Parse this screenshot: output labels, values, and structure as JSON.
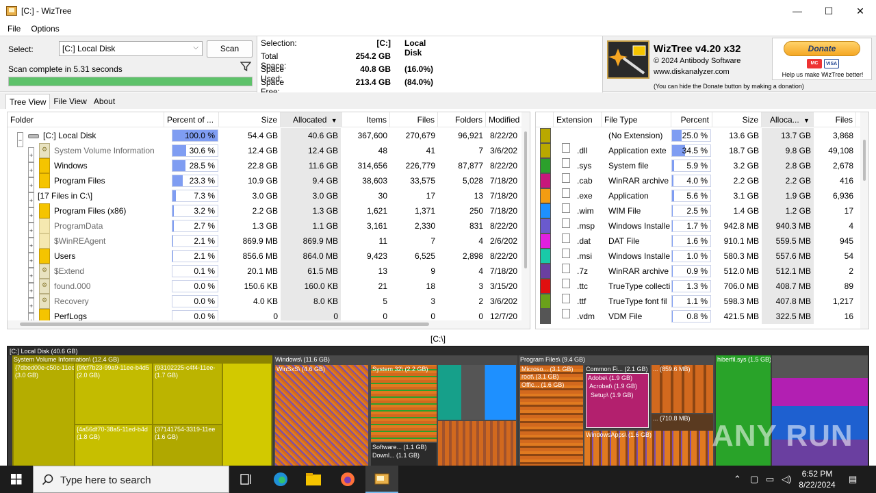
{
  "window": {
    "title": "[C:]  - WizTree",
    "minimize": "—",
    "maximize": "☐",
    "close": "✕"
  },
  "menu": [
    "File",
    "Options"
  ],
  "scan": {
    "select_label": "Select:",
    "drive": "[C:] Local Disk",
    "scan_button": "Scan",
    "status": "Scan complete in 5.31 seconds",
    "progress": 1.0
  },
  "selection": {
    "rows": [
      {
        "label": "Selection:",
        "value": "[C:]",
        "extra": "Local Disk"
      },
      {
        "label": "Total Space:",
        "value": "254.2 GB",
        "extra": ""
      },
      {
        "label": "Space Used:",
        "value": "40.8 GB",
        "extra": "(16.0%)"
      },
      {
        "label": "Space Free:",
        "value": "213.4 GB",
        "extra": "(84.0%)"
      }
    ]
  },
  "brand": {
    "name": "WizTree v4.20 x32",
    "copyright": "© 2024 Antibody Software",
    "website": "www.diskanalyzer.com",
    "hint": "(You can hide the Donate button by making a donation)"
  },
  "donate": {
    "button": "Donate",
    "card1": "MC",
    "card2": "VISA",
    "sub": "Help us make WizTree better!"
  },
  "tabs": [
    "Tree View",
    "File View",
    "About"
  ],
  "folder_table": {
    "columns": [
      "Folder",
      "Percent of ...",
      "Size",
      "Allocated",
      "Items",
      "Files",
      "Folders",
      "Modified"
    ],
    "rows": [
      {
        "name": "[C:] Local Disk",
        "pct": 100.0,
        "pct_text": "100.0 %",
        "size": "54.4 GB",
        "alloc": "40.6 GB",
        "items": "367,600",
        "files": "270,679",
        "folders": "96,921",
        "modified": "8/22/20",
        "icon": "disk",
        "dim": false,
        "level": 0
      },
      {
        "name": "System Volume Information",
        "pct": 30.6,
        "pct_text": "30.6 %",
        "size": "12.4 GB",
        "alloc": "12.4 GB",
        "items": "48",
        "files": "41",
        "folders": "7",
        "modified": "3/6/202",
        "icon": "sys",
        "dim": true,
        "level": 1
      },
      {
        "name": "Windows",
        "pct": 28.5,
        "pct_text": "28.5 %",
        "size": "22.8 GB",
        "alloc": "11.6 GB",
        "items": "314,656",
        "files": "226,779",
        "folders": "87,877",
        "modified": "8/22/20",
        "icon": "yellow",
        "dim": false,
        "level": 1
      },
      {
        "name": "Program Files",
        "pct": 23.3,
        "pct_text": "23.3 %",
        "size": "10.9 GB",
        "alloc": "9.4 GB",
        "items": "38,603",
        "files": "33,575",
        "folders": "5,028",
        "modified": "7/18/20",
        "icon": "yellow",
        "dim": false,
        "level": 1
      },
      {
        "name": "[17 Files in C:\\]",
        "pct": 7.3,
        "pct_text": "7.3 %",
        "size": "3.0 GB",
        "alloc": "3.0 GB",
        "items": "30",
        "files": "17",
        "folders": "13",
        "modified": "7/18/20",
        "icon": "none",
        "dim": false,
        "level": 1
      },
      {
        "name": "Program Files (x86)",
        "pct": 3.2,
        "pct_text": "3.2 %",
        "size": "2.2 GB",
        "alloc": "1.3 GB",
        "items": "1,621",
        "files": "1,371",
        "folders": "250",
        "modified": "7/18/20",
        "icon": "yellow",
        "dim": false,
        "level": 1
      },
      {
        "name": "ProgramData",
        "pct": 2.7,
        "pct_text": "2.7 %",
        "size": "1.3 GB",
        "alloc": "1.1 GB",
        "items": "3,161",
        "files": "2,330",
        "folders": "831",
        "modified": "8/22/20",
        "icon": "pale",
        "dim": true,
        "level": 1
      },
      {
        "name": "$WinREAgent",
        "pct": 2.1,
        "pct_text": "2.1 %",
        "size": "869.9 MB",
        "alloc": "869.9 MB",
        "items": "11",
        "files": "7",
        "folders": "4",
        "modified": "2/6/202",
        "icon": "pale",
        "dim": true,
        "level": 1
      },
      {
        "name": "Users",
        "pct": 2.1,
        "pct_text": "2.1 %",
        "size": "856.6 MB",
        "alloc": "864.0 MB",
        "items": "9,423",
        "files": "6,525",
        "folders": "2,898",
        "modified": "8/22/20",
        "icon": "yellow",
        "dim": false,
        "level": 1
      },
      {
        "name": "$Extend",
        "pct": 0.1,
        "pct_text": "0.1 %",
        "size": "20.1 MB",
        "alloc": "61.5 MB",
        "items": "13",
        "files": "9",
        "folders": "4",
        "modified": "7/18/20",
        "icon": "sys",
        "dim": true,
        "level": 1
      },
      {
        "name": "found.000",
        "pct": 0.0,
        "pct_text": "0.0 %",
        "size": "150.6 KB",
        "alloc": "160.0 KB",
        "items": "21",
        "files": "18",
        "folders": "3",
        "modified": "3/15/20",
        "icon": "sys",
        "dim": true,
        "level": 1
      },
      {
        "name": "Recovery",
        "pct": 0.0,
        "pct_text": "0.0 %",
        "size": "4.0 KB",
        "alloc": "8.0 KB",
        "items": "5",
        "files": "3",
        "folders": "2",
        "modified": "3/6/202",
        "icon": "sys",
        "dim": true,
        "level": 1
      },
      {
        "name": "PerfLogs",
        "pct": 0.0,
        "pct_text": "0.0 %",
        "size": "0",
        "alloc": "0",
        "items": "0",
        "files": "0",
        "folders": "0",
        "modified": "12/7/20",
        "icon": "yellow",
        "dim": false,
        "level": 1
      }
    ]
  },
  "ext_table": {
    "columns": [
      "Extension",
      "File Type",
      "Percent",
      "Size",
      "Alloca...",
      "Files"
    ],
    "rows": [
      {
        "color": "#b9a800",
        "ext": "",
        "type": "(No Extension)",
        "pct": 25.0,
        "pct_text": "25.0 %",
        "size": "13.6 GB",
        "alloc": "13.7 GB",
        "files": "3,868"
      },
      {
        "color": "#b9a800",
        "ext": ".dll",
        "type": "Application exte",
        "pct": 34.5,
        "pct_text": "34.5 %",
        "size": "18.7 GB",
        "alloc": "9.8 GB",
        "files": "49,108"
      },
      {
        "color": "#2ca02c",
        "ext": ".sys",
        "type": "System file",
        "pct": 5.9,
        "pct_text": "5.9 %",
        "size": "3.2 GB",
        "alloc": "2.8 GB",
        "files": "2,678"
      },
      {
        "color": "#c7187b",
        "ext": ".cab",
        "type": "WinRAR archive",
        "pct": 4.0,
        "pct_text": "4.0 %",
        "size": "2.2 GB",
        "alloc": "2.2 GB",
        "files": "416"
      },
      {
        "color": "#f39c12",
        "ext": ".exe",
        "type": "Application",
        "pct": 5.6,
        "pct_text": "5.6 %",
        "size": "3.1 GB",
        "alloc": "1.9 GB",
        "files": "6,936"
      },
      {
        "color": "#1e90ff",
        "ext": ".wim",
        "type": "WIM File",
        "pct": 2.5,
        "pct_text": "2.5 %",
        "size": "1.4 GB",
        "alloc": "1.2 GB",
        "files": "17"
      },
      {
        "color": "#6a5acd",
        "ext": ".msp",
        "type": "Windows Installe",
        "pct": 1.7,
        "pct_text": "1.7 %",
        "size": "942.8 MB",
        "alloc": "940.3 MB",
        "files": "4"
      },
      {
        "color": "#e020e0",
        "ext": ".dat",
        "type": "DAT File",
        "pct": 1.6,
        "pct_text": "1.6 %",
        "size": "910.1 MB",
        "alloc": "559.5 MB",
        "files": "945"
      },
      {
        "color": "#19c9a8",
        "ext": ".msi",
        "type": "Windows Installe",
        "pct": 1.0,
        "pct_text": "1.0 %",
        "size": "580.3 MB",
        "alloc": "557.6 MB",
        "files": "54"
      },
      {
        "color": "#6b3fa0",
        "ext": ".7z",
        "type": "WinRAR archive",
        "pct": 0.9,
        "pct_text": "0.9 %",
        "size": "512.0 MB",
        "alloc": "512.1 MB",
        "files": "2"
      },
      {
        "color": "#e01010",
        "ext": ".ttc",
        "type": "TrueType collecti",
        "pct": 1.3,
        "pct_text": "1.3 %",
        "size": "706.0 MB",
        "alloc": "408.7 MB",
        "files": "89"
      },
      {
        "color": "#6aa11a",
        "ext": ".ttf",
        "type": "TrueType font fil",
        "pct": 1.1,
        "pct_text": "1.1 %",
        "size": "598.3 MB",
        "alloc": "407.8 MB",
        "files": "1,217"
      },
      {
        "color": "#555555",
        "ext": ".vdm",
        "type": "VDM File",
        "pct": 0.8,
        "pct_text": "0.8 %",
        "size": "421.5 MB",
        "alloc": "322.5 MB",
        "files": "16"
      }
    ]
  },
  "path": "[C:\\]",
  "treemap": {
    "root": "[C:] Local Disk  (40.6 GB)",
    "labels": {
      "svi": "System Volume Information\\ (12.4 GB)",
      "b1": "{7dbed00e-c50c-11ee",
      "b1s": "(3.0 GB)",
      "b2": "{9fcf7b23-99a9-11ee-b4d5",
      "b2s": "(2.0 GB)",
      "b3": "{93102225-c4f4-11ee-",
      "b3s": "(1.7 GB)",
      "b4": "{4a56df70-38a5-11ed-b4d",
      "b4s": "(1.8 GB)",
      "b5": "{37141754-3319-11ee",
      "b5s": "(1.6 GB)",
      "windows": "Windows\\ (11.6 GB)",
      "winsxs": "WinSxS\\ (4.6 GB)",
      "sys32": "System 32\\ (2.2 GB)",
      "software": "Software... (1.1 GB)",
      "download": "Downl... (1.1 GB)",
      "pf": "Program Files\\ (9.4 GB)",
      "microsoft": "Microso... (3.1 GB)",
      "root": "root\\ (3.1 GB)",
      "office": "Offic... (1.6 GB)",
      "common": "Common Fi... (2.1 GB)",
      "adobe": "Adobe\\ (1.9 GB)",
      "acrobat": "Acrobat\\ (1.9 GB)",
      "setup": "Setup\\ (1.9 GB)",
      "x1": "... (859.6 MB)",
      "x2": "... (710.8 MB)",
      "winapps": "WindowsApps\\ (1.6 GB)",
      "hiberfil": "hiberfil.sys (1.5 GB)"
    }
  },
  "watermark": "ANY RUN",
  "taskbar": {
    "search_placeholder": "Type here to search",
    "time": "6:52 PM",
    "date": "8/22/2024"
  },
  "colors": {
    "progress": "#5ec26a",
    "pct_bar": "#7f9df2",
    "accent": "#76b9ed"
  }
}
